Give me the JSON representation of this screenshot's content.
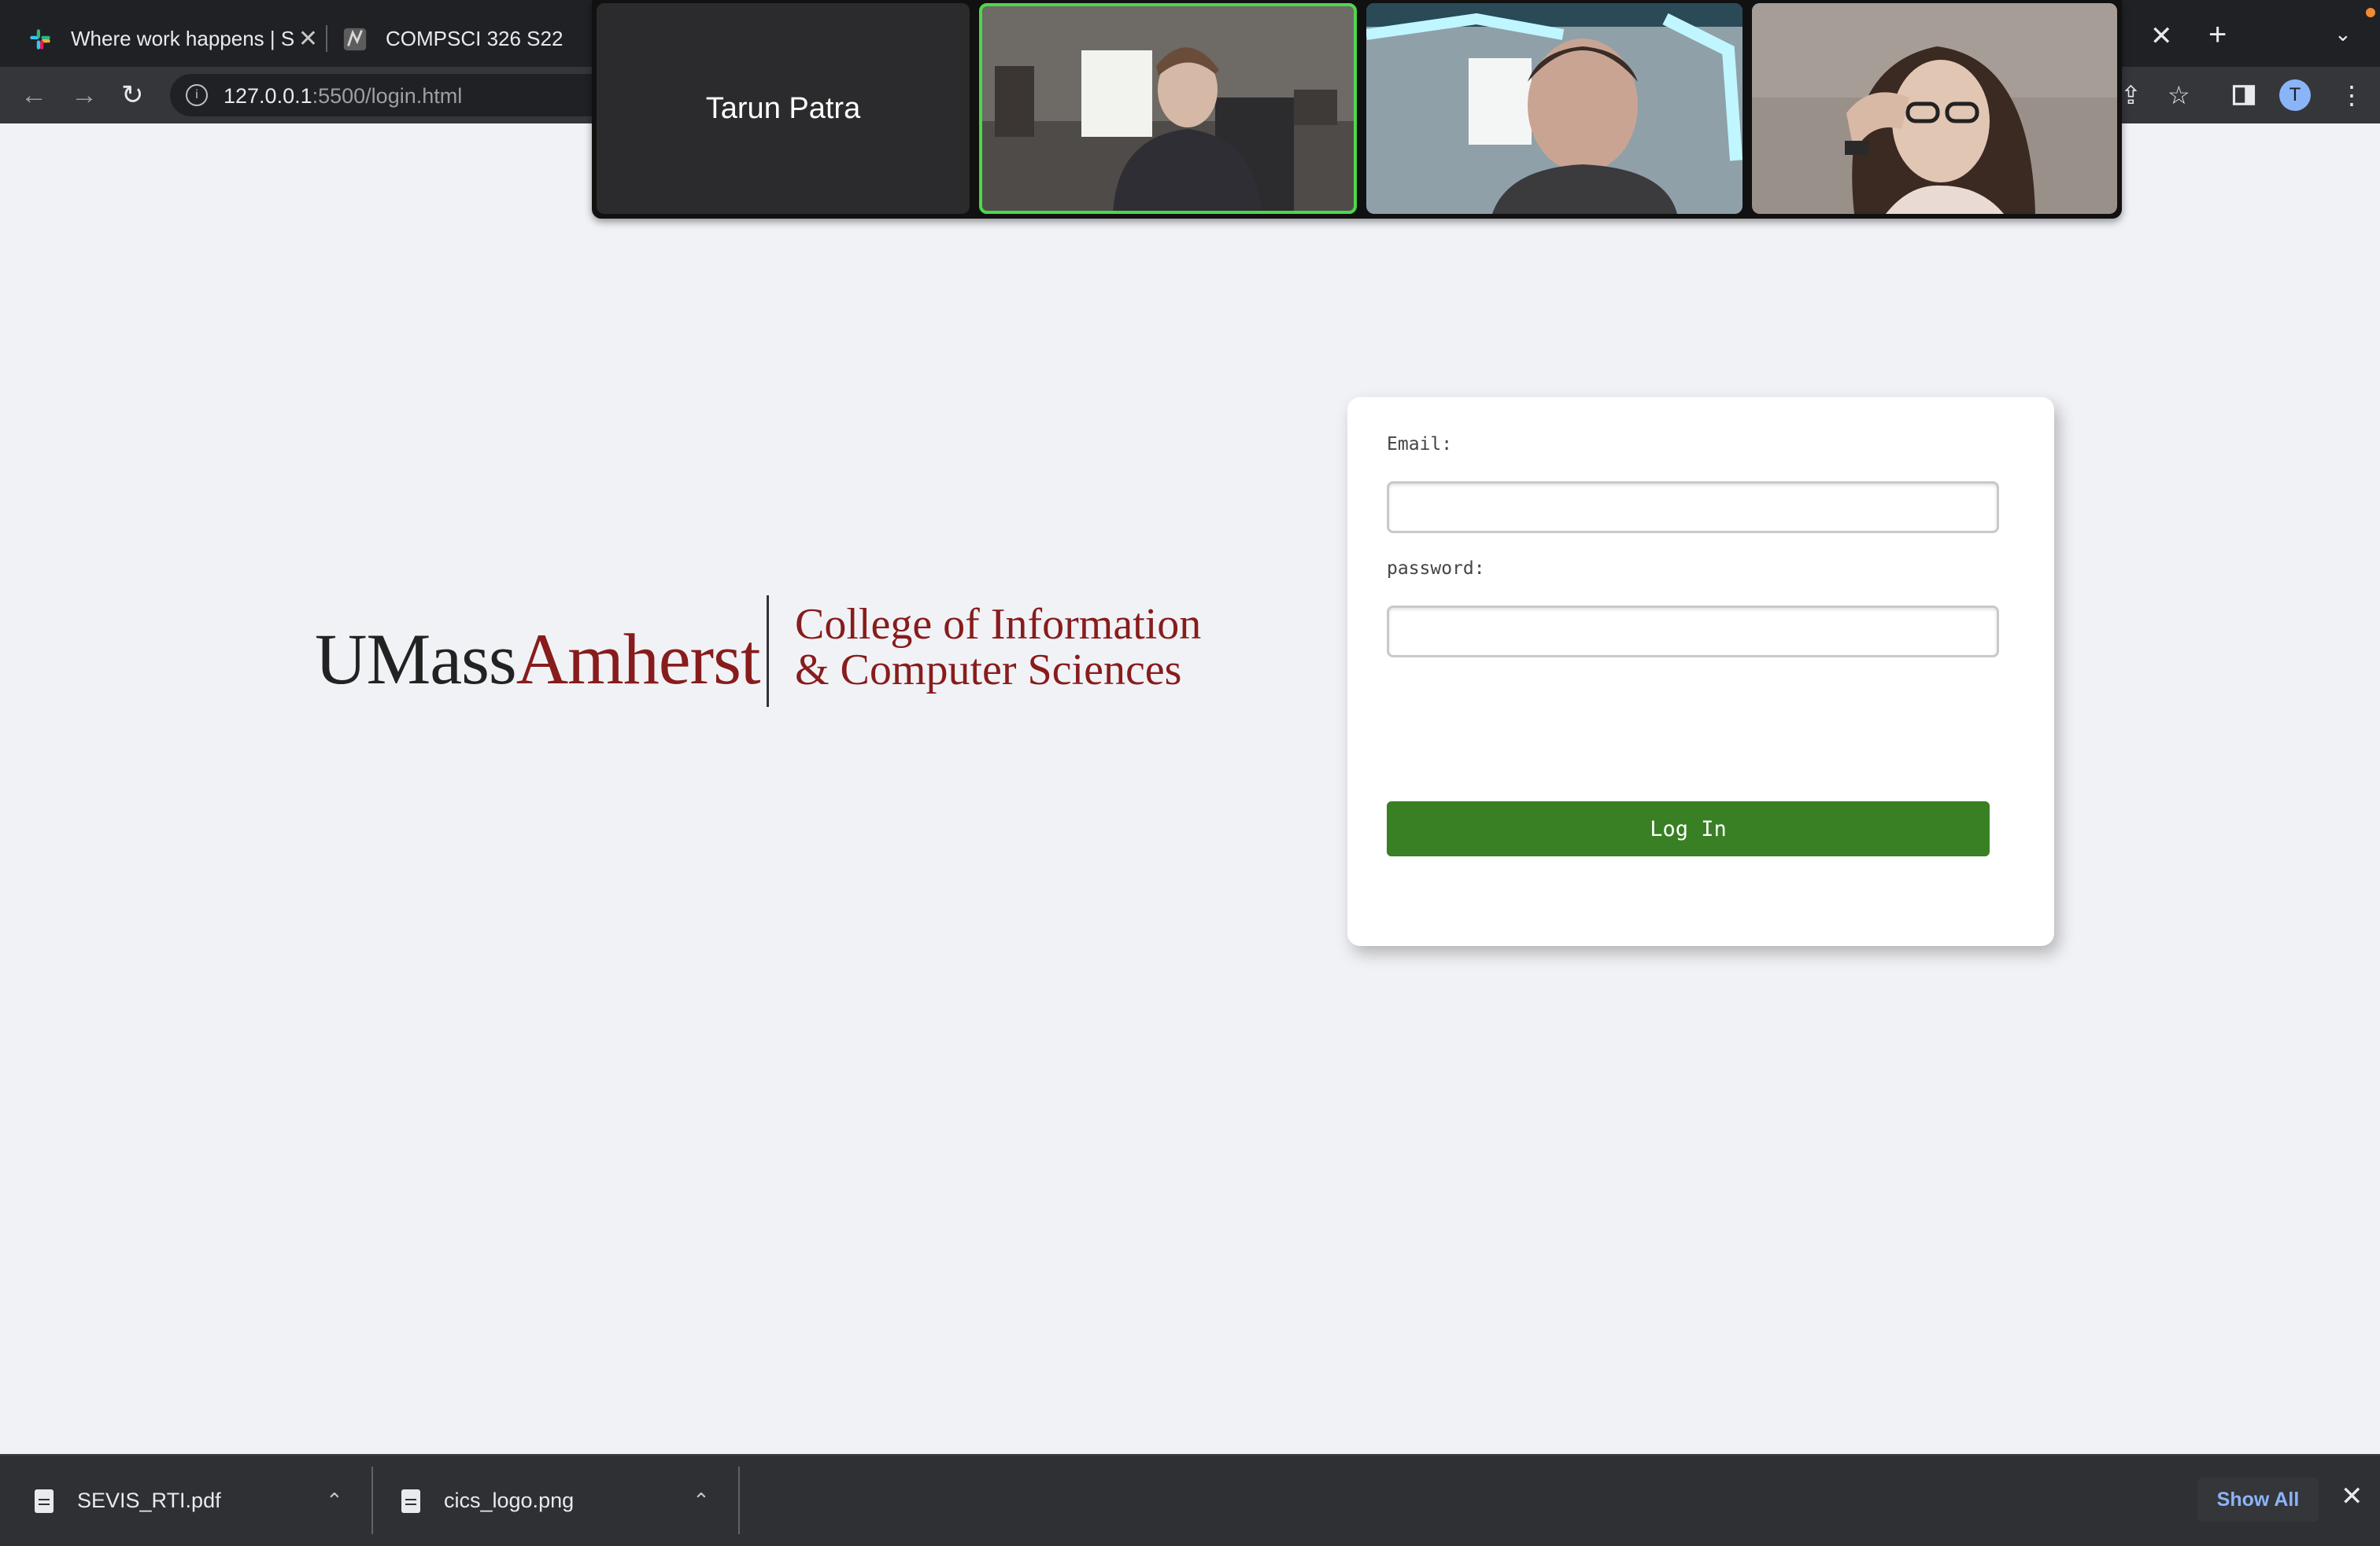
{
  "browser": {
    "tabs": [
      {
        "title": "Where work happens | S",
        "active": false
      },
      {
        "title": "COMPSCI 326 S22",
        "active": false
      }
    ],
    "url": {
      "host": "127.0.0.1",
      "path": ":5500/login.html"
    },
    "profile_initial": "T"
  },
  "call": {
    "participants": [
      {
        "name": "Tarun Patra",
        "video": false
      },
      {
        "name": "",
        "video": true,
        "speaking": true
      },
      {
        "name": "",
        "video": true,
        "speaking": false
      },
      {
        "name": "",
        "video": true,
        "speaking": false
      }
    ]
  },
  "logo": {
    "umass": "UMass",
    "amherst": "Amherst",
    "college_line1": "College of Information",
    "college_line2": "& Computer Sciences"
  },
  "login": {
    "email_label": "Email:",
    "email_value": "",
    "password_label": "password:",
    "password_value": "",
    "button_label": "Log In"
  },
  "downloads": {
    "items": [
      {
        "filename": "SEVIS_RTI.pdf"
      },
      {
        "filename": "cics_logo.png"
      }
    ],
    "show_all_label": "Show All"
  },
  "colors": {
    "page_bg": "#f1f2f6",
    "button_green": "#388023",
    "umass_maroon": "#881c1c",
    "speaker_highlight": "#4ad94a"
  }
}
